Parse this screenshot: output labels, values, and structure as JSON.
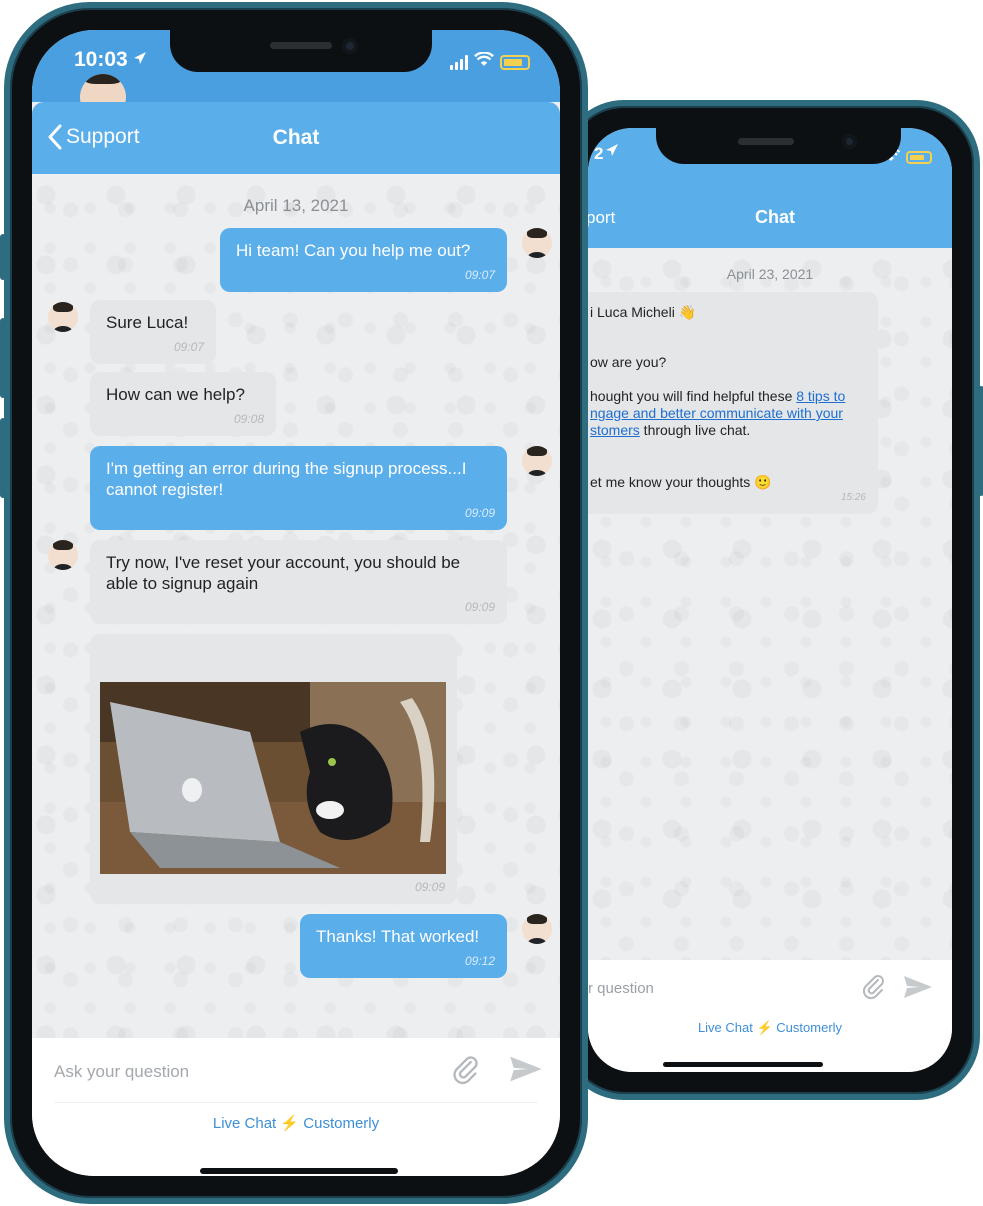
{
  "front": {
    "status": {
      "time": "10:03"
    },
    "header": {
      "back_label": "Support",
      "title": "Chat"
    },
    "date": "April 13, 2021",
    "messages": [
      {
        "text": "Hi team! Can you help me out?",
        "time": "09:07"
      },
      {
        "text": "Sure Luca!",
        "time": "09:07"
      },
      {
        "text": "How can we help?",
        "time": "09:08"
      },
      {
        "text": "I'm getting an error during the signup process...I cannot register!",
        "time": "09:09"
      },
      {
        "text": "Try now, I've reset your account, you should be able to signup again",
        "time": "09:09"
      },
      {
        "time": "09:09"
      },
      {
        "text": "Thanks! That worked!",
        "time": "09:12"
      }
    ],
    "input": {
      "placeholder": "Ask your question"
    },
    "footer": {
      "left": "Live Chat",
      "right": "Customerly"
    }
  },
  "back": {
    "status": {
      "time": "2"
    },
    "header": {
      "back_label": "port",
      "title": "Chat"
    },
    "date": "April 23, 2021",
    "message": {
      "line1": "i Luca Micheli",
      "line2": "ow are you?",
      "line3_pre": "hought you will find helpful these ",
      "line3_link1": "8 tips to",
      "line4_link": "ngage and better communicate with your",
      "line5_link": "stomers",
      "line5_post": " through live chat.",
      "line6": "et me know your thoughts",
      "time": "15:26"
    },
    "input": {
      "placeholder": "r question"
    },
    "footer": {
      "left": "Live Chat",
      "right": "Customerly"
    }
  },
  "colors": {
    "header": "#5aaeea",
    "outgoing_bubble": "#5aaeea",
    "incoming_bubble": "#e4e6e8",
    "brand_link": "#3d8fd6",
    "frame": "#2e6c80"
  },
  "icons": [
    "chevron-left-icon",
    "location-arrow-icon",
    "signal-icon",
    "wifi-icon",
    "battery-icon",
    "paperclip-icon",
    "send-icon",
    "lightning-icon",
    "wave-emoji-icon",
    "smile-emoji-icon"
  ]
}
